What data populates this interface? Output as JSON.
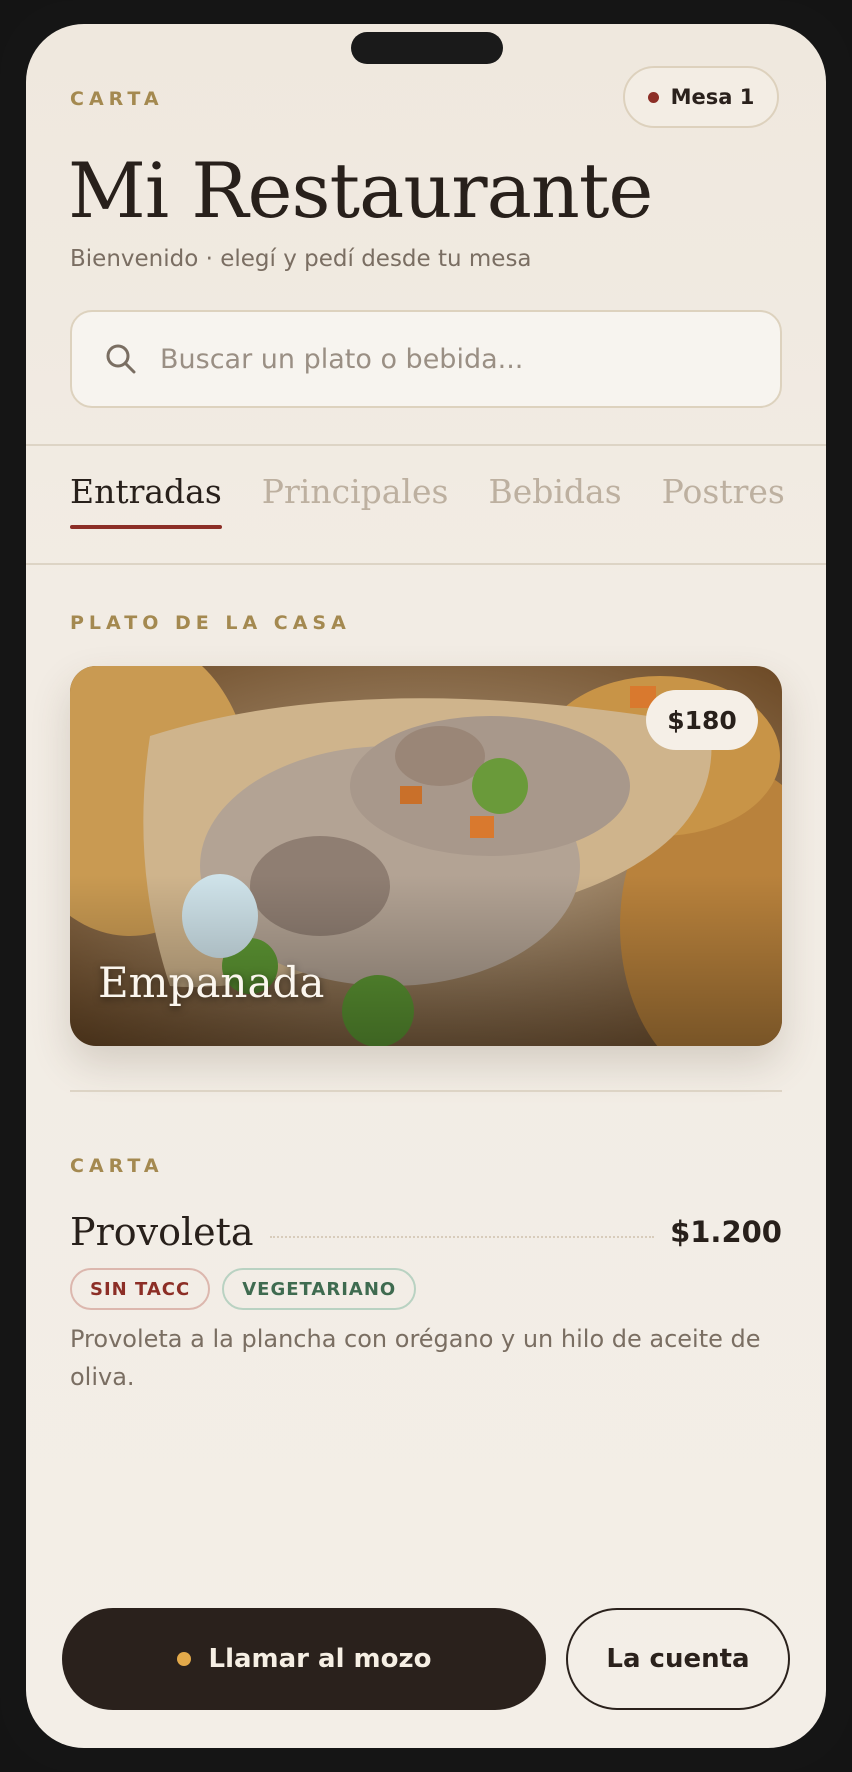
{
  "header": {
    "eyebrow": "CARTA",
    "table_label": "Mesa 1",
    "title": "Mi Restaurante",
    "subtitle": "Bienvenido · elegí y pedí desde tu mesa"
  },
  "search": {
    "placeholder": "Buscar un plato o bebida...",
    "value": ""
  },
  "tabs": [
    {
      "label": "Entradas",
      "active": true
    },
    {
      "label": "Principales",
      "active": false
    },
    {
      "label": "Bebidas",
      "active": false
    },
    {
      "label": "Postres",
      "active": false
    }
  ],
  "featured": {
    "eyebrow": "PLATO DE LA CASA",
    "name": "Empanada",
    "price": "$180"
  },
  "menu": {
    "eyebrow": "CARTA",
    "items": [
      {
        "name": "Provoleta",
        "price": "$1.200",
        "tags": [
          "SIN TACC",
          "VEGETARIANO"
        ],
        "description": "Provoleta a la plancha con orégano y un hilo de aceite de oliva."
      }
    ]
  },
  "actions": {
    "call_waiter": "Llamar al mozo",
    "bill": "La cuenta"
  },
  "colors": {
    "accent": "#8c2e26",
    "gold": "#a48950",
    "dark": "#2a211c",
    "background": "#f2ece4"
  }
}
